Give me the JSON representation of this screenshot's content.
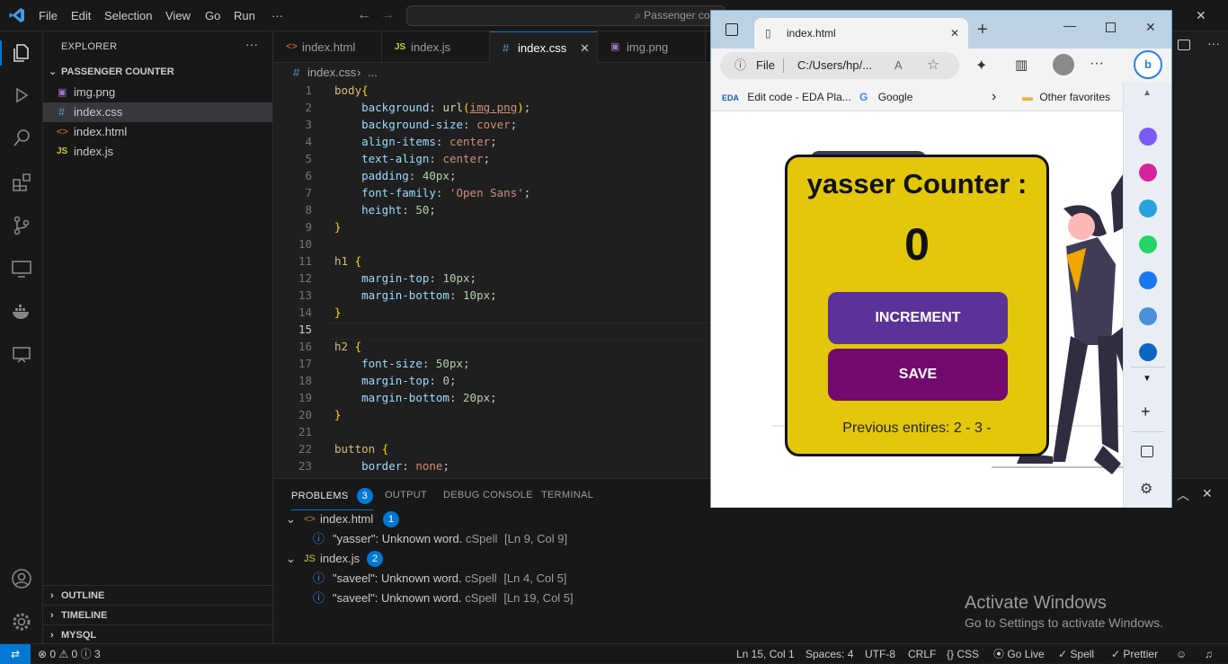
{
  "titlebar": {
    "menus": [
      "File",
      "Edit",
      "Selection",
      "View",
      "Go",
      "Run",
      "···"
    ],
    "search": "Passenger counter"
  },
  "sidebar": {
    "title": "EXPLORER",
    "folder": "PASSENGER COUNTER",
    "files": [
      {
        "name": "img.png",
        "icon": "image-icon"
      },
      {
        "name": "index.css",
        "icon": "css-icon"
      },
      {
        "name": "index.html",
        "icon": "html-icon"
      },
      {
        "name": "index.js",
        "icon": "js-icon"
      }
    ],
    "sections": [
      "OUTLINE",
      "TIMELINE",
      "MYSQL"
    ]
  },
  "tabs": [
    {
      "label": "index.html",
      "glyph": "<>",
      "color": "#e37933"
    },
    {
      "label": "index.js",
      "glyph": "JS",
      "color": "#cbcb41"
    },
    {
      "label": "index.css",
      "glyph": "#",
      "color": "#519aba"
    },
    {
      "label": "img.png",
      "glyph": "▣",
      "color": "#a074c4"
    }
  ],
  "breadcrumb": {
    "file": "index.css",
    "tail": "..."
  },
  "editor": {
    "lines": [
      {
        "n": "1",
        "segs": [
          [
            "sel",
            "body"
          ],
          [
            "br",
            "{"
          ]
        ]
      },
      {
        "n": "2",
        "segs": [
          [
            "",
            "    "
          ],
          [
            "prop",
            "background"
          ],
          [
            "",
            ": "
          ],
          [
            "fn",
            "url"
          ],
          [
            "br",
            "("
          ],
          [
            "url",
            "img.png"
          ],
          [
            "br",
            ")"
          ],
          [
            "",
            ";"
          ]
        ]
      },
      {
        "n": "3",
        "segs": [
          [
            "",
            "    "
          ],
          [
            "prop",
            "background-size"
          ],
          [
            "",
            ": "
          ],
          [
            "val",
            "cover"
          ],
          [
            "",
            ";"
          ]
        ]
      },
      {
        "n": "4",
        "segs": [
          [
            "",
            "    "
          ],
          [
            "prop",
            "align-items"
          ],
          [
            "",
            ": "
          ],
          [
            "val",
            "center"
          ],
          [
            "",
            ";"
          ]
        ]
      },
      {
        "n": "5",
        "segs": [
          [
            "",
            "    "
          ],
          [
            "prop",
            "text-align"
          ],
          [
            "",
            ": "
          ],
          [
            "val",
            "center"
          ],
          [
            "",
            ";"
          ]
        ]
      },
      {
        "n": "6",
        "segs": [
          [
            "",
            "    "
          ],
          [
            "prop",
            "padding"
          ],
          [
            "",
            ": "
          ],
          [
            "num",
            "40px"
          ],
          [
            "",
            ";"
          ]
        ]
      },
      {
        "n": "7",
        "segs": [
          [
            "",
            "    "
          ],
          [
            "prop",
            "font-family"
          ],
          [
            "",
            ": "
          ],
          [
            "val",
            "'Open Sans'"
          ],
          [
            "",
            ";"
          ]
        ]
      },
      {
        "n": "8",
        "segs": [
          [
            "",
            "    "
          ],
          [
            "prop",
            "height"
          ],
          [
            "",
            ": "
          ],
          [
            "num",
            "50"
          ],
          [
            "",
            ";"
          ]
        ]
      },
      {
        "n": "9",
        "segs": [
          [
            "br",
            "}"
          ]
        ]
      },
      {
        "n": "10",
        "segs": []
      },
      {
        "n": "11",
        "segs": [
          [
            "sel",
            "h1"
          ],
          [
            "",
            " "
          ],
          [
            "br",
            "{"
          ]
        ]
      },
      {
        "n": "12",
        "segs": [
          [
            "",
            "    "
          ],
          [
            "prop",
            "margin-top"
          ],
          [
            "",
            ": "
          ],
          [
            "num",
            "10px"
          ],
          [
            "",
            ";"
          ]
        ]
      },
      {
        "n": "13",
        "segs": [
          [
            "",
            "    "
          ],
          [
            "prop",
            "margin-bottom"
          ],
          [
            "",
            ": "
          ],
          [
            "num",
            "10px"
          ],
          [
            "",
            ";"
          ]
        ]
      },
      {
        "n": "14",
        "segs": [
          [
            "br",
            "}"
          ]
        ]
      },
      {
        "n": "15",
        "segs": []
      },
      {
        "n": "16",
        "segs": [
          [
            "sel",
            "h2"
          ],
          [
            "",
            " "
          ],
          [
            "br",
            "{"
          ]
        ]
      },
      {
        "n": "17",
        "segs": [
          [
            "",
            "    "
          ],
          [
            "prop",
            "font-size"
          ],
          [
            "",
            ": "
          ],
          [
            "num",
            "50px"
          ],
          [
            "",
            ";"
          ]
        ]
      },
      {
        "n": "18",
        "segs": [
          [
            "",
            "    "
          ],
          [
            "prop",
            "margin-top"
          ],
          [
            "",
            ": "
          ],
          [
            "num",
            "0"
          ],
          [
            "",
            ";"
          ]
        ]
      },
      {
        "n": "19",
        "segs": [
          [
            "",
            "    "
          ],
          [
            "prop",
            "margin-bottom"
          ],
          [
            "",
            ": "
          ],
          [
            "num",
            "20px"
          ],
          [
            "",
            ";"
          ]
        ]
      },
      {
        "n": "20",
        "segs": [
          [
            "br",
            "}"
          ]
        ]
      },
      {
        "n": "21",
        "segs": []
      },
      {
        "n": "22",
        "segs": [
          [
            "sel",
            "button"
          ],
          [
            "",
            " "
          ],
          [
            "br",
            "{"
          ]
        ]
      },
      {
        "n": "23",
        "segs": [
          [
            "",
            "    "
          ],
          [
            "prop",
            "border"
          ],
          [
            "",
            ": "
          ],
          [
            "val",
            "none"
          ],
          [
            "",
            ";"
          ]
        ]
      }
    ],
    "current_line": "15"
  },
  "panel": {
    "tabs": [
      "PROBLEMS",
      "OUTPUT",
      "DEBUG CONSOLE",
      "TERMINAL"
    ],
    "problem_count": "3",
    "groups": [
      {
        "file": "index.html",
        "glyph": "<>",
        "color": "#e37933",
        "count": "1",
        "items": [
          {
            "msg": "\"yasser\": Unknown word.",
            "src": "cSpell",
            "loc": "[Ln 9, Col 9]"
          }
        ]
      },
      {
        "file": "index.js",
        "glyph": "JS",
        "color": "#cbcb41",
        "count": "2",
        "items": [
          {
            "msg": "\"saveel\": Unknown word.",
            "src": "cSpell",
            "loc": "[Ln 4, Col 5]"
          },
          {
            "msg": "\"saveel\": Unknown word.",
            "src": "cSpell",
            "loc": "[Ln 19, Col 5]"
          }
        ]
      }
    ]
  },
  "statusbar": {
    "errors": "0",
    "warnings": "0",
    "infos": "3",
    "right": [
      "Ln 15, Col 1",
      "Spaces: 4",
      "UTF-8",
      "CRLF",
      "{} CSS",
      "Go Live",
      "Spell",
      "Prettier"
    ]
  },
  "watermark": {
    "title": "Activate Windows",
    "sub": "Go to Settings to activate Windows."
  },
  "browser": {
    "tab_title": "index.html",
    "url_scheme": "File",
    "url": "C:/Users/hp/...",
    "favorites": [
      {
        "label": "Edit code - EDA Pla..."
      },
      {
        "label": "Google"
      }
    ],
    "other_favorites": "Other favorites",
    "sidebar_icons": [
      {
        "name": "messenger-icon",
        "color": "#7a5cf5"
      },
      {
        "name": "instagram-icon",
        "color": "#d6249f"
      },
      {
        "name": "telegram-icon",
        "color": "#2aa1da"
      },
      {
        "name": "whatsapp-icon",
        "color": "#25d366"
      },
      {
        "name": "facebook-icon",
        "color": "#1877f2"
      },
      {
        "name": "translate-icon",
        "color": "#4a90d9"
      },
      {
        "name": "linkedin-icon",
        "color": "#0a66c2"
      }
    ],
    "app": {
      "title": "yasser Counter :",
      "count": "0",
      "increment": "INCREMENT",
      "save": "SAVE",
      "previous": "Previous entires: 2 - 3 -",
      "colors": {
        "card": "#e2c70a",
        "increment": "#5b3398",
        "save": "#720a6e"
      }
    }
  }
}
